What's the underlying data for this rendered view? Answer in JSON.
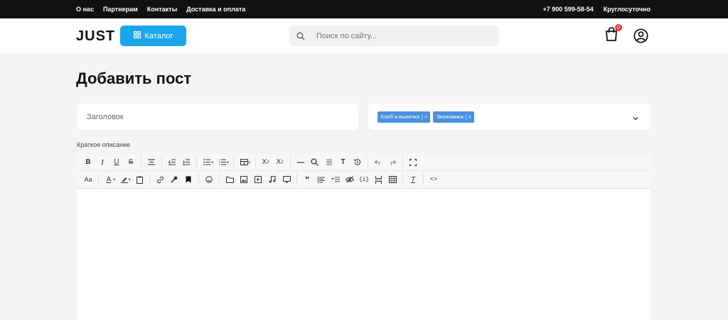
{
  "topbar": {
    "links": [
      "О нас",
      "Партнерам",
      "Контакты",
      "Доставка и оплата"
    ],
    "phone": "+7 900 599-58-54",
    "hours": "Круглосуточно"
  },
  "header": {
    "logo": "JUST",
    "catalog_label": "Каталог",
    "search_placeholder": "Поиск по сайту...",
    "cart_count": "0"
  },
  "page": {
    "title": "Добавить пост",
    "title_placeholder": "Заголовок",
    "tags": [
      "Хлеб и выпечка",
      "Экономика"
    ],
    "description_label": "Краткое описание"
  },
  "colors": {
    "accent": "#1ba5ec",
    "tag": "#4a90e2",
    "badge": "#e43a3a"
  },
  "toolbar": {
    "row1": [
      "bold-icon",
      "italic-icon",
      "underline-icon",
      "strikethrough-icon",
      "align-center-icon",
      "outdent-icon",
      "indent-icon",
      "bullet-list-icon",
      "numbered-list-icon",
      "table-icon",
      "subscript-icon",
      "superscript-icon",
      "horizontal-rule-icon",
      "find-icon",
      "select-all-icon",
      "format-text-icon",
      "history-icon",
      "undo-icon",
      "redo-icon",
      "fullscreen-icon"
    ],
    "row2": [
      "font-size-icon",
      "font-color-icon",
      "highlight-icon",
      "paste-icon",
      "link-icon",
      "tools-icon",
      "bookmark-icon",
      "emoji-icon",
      "folder-icon",
      "image-icon",
      "video-icon",
      "audio-icon",
      "embed-icon",
      "quote-icon",
      "paragraph-icon",
      "list-style-icon",
      "hide-icon",
      "code-braces-icon",
      "page-break-icon",
      "template-icon",
      "clear-format-icon",
      "source-code-icon"
    ]
  }
}
